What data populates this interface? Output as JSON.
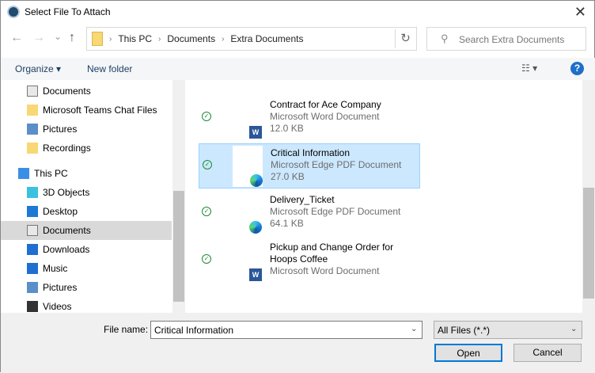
{
  "window": {
    "title": "Select File To Attach",
    "close": "✕"
  },
  "nav": {
    "back": "←",
    "forward": "→",
    "recent": "⌄",
    "up": "↑"
  },
  "breadcrumb": [
    "This PC",
    "Documents",
    "Extra Documents"
  ],
  "search": {
    "placeholder": "Search Extra Documents"
  },
  "toolbar": {
    "organize": "Organize ▾",
    "new_folder": "New folder",
    "help": "?"
  },
  "sidebar": {
    "items": [
      {
        "label": "Documents",
        "icon": "document-icon"
      },
      {
        "label": "Microsoft Teams Chat Files",
        "icon": "folder-icon"
      },
      {
        "label": "Pictures",
        "icon": "pictures-icon"
      },
      {
        "label": "Recordings",
        "icon": "folder-icon"
      },
      {
        "label": "This PC",
        "icon": "computer-icon"
      },
      {
        "label": "3D Objects",
        "icon": "cube-icon"
      },
      {
        "label": "Desktop",
        "icon": "desktop-icon"
      },
      {
        "label": "Documents",
        "icon": "document-icon",
        "selected": true
      },
      {
        "label": "Downloads",
        "icon": "download-icon"
      },
      {
        "label": "Music",
        "icon": "music-icon"
      },
      {
        "label": "Pictures",
        "icon": "pictures-icon"
      },
      {
        "label": "Videos",
        "icon": "video-icon"
      }
    ]
  },
  "files": [
    {
      "name": "Contract for Ace Company",
      "type": "Microsoft Word Document",
      "size": "12.0 KB",
      "app": "word"
    },
    {
      "name": "Critical Information",
      "type": "Microsoft Edge PDF Document",
      "size": "27.0 KB",
      "app": "edge",
      "selected": true
    },
    {
      "name": "Delivery_Ticket",
      "type": "Microsoft Edge PDF Document",
      "size": "64.1 KB",
      "app": "edge"
    },
    {
      "name": "Pickup and Change Order for Hoops Coffee",
      "type": "Microsoft Word Document",
      "app": "word"
    }
  ],
  "footer": {
    "file_name_label": "File name:",
    "file_name_value": "Critical Information",
    "filter": "All Files (*.*)",
    "open": "Open",
    "cancel": "Cancel"
  }
}
